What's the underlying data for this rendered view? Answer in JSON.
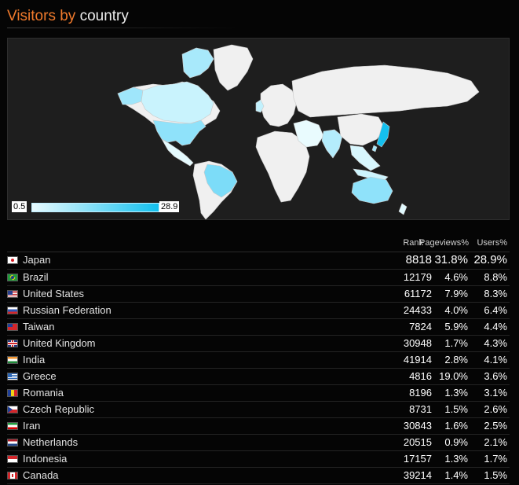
{
  "page": {
    "title_accent": "Visitors by",
    "title_rest": " country"
  },
  "map": {
    "legend_min": "0.5",
    "legend_max": "28.9",
    "color_low": "#e8fbff",
    "color_high": "#12c0ee",
    "land_color": "#f0f0f0"
  },
  "table": {
    "headers": {
      "rank": "Rank",
      "pageviews": "Pageviews%",
      "users": "Users%"
    },
    "rows": [
      {
        "country": "Japan",
        "flag": "jp-flag-icon",
        "rank": "8818",
        "pageviews": "31.8%",
        "users": "28.9%"
      },
      {
        "country": "Brazil",
        "flag": "br-flag-icon",
        "rank": "12179",
        "pageviews": "4.6%",
        "users": "8.8%"
      },
      {
        "country": "United States",
        "flag": "us-flag-icon",
        "rank": "61172",
        "pageviews": "7.9%",
        "users": "8.3%"
      },
      {
        "country": "Russian Federation",
        "flag": "ru-flag-icon",
        "rank": "24433",
        "pageviews": "4.0%",
        "users": "6.4%"
      },
      {
        "country": "Taiwan",
        "flag": "tw-flag-icon",
        "rank": "7824",
        "pageviews": "5.9%",
        "users": "4.4%"
      },
      {
        "country": "United Kingdom",
        "flag": "gb-flag-icon",
        "rank": "30948",
        "pageviews": "1.7%",
        "users": "4.3%"
      },
      {
        "country": "India",
        "flag": "in-flag-icon",
        "rank": "41914",
        "pageviews": "2.8%",
        "users": "4.1%"
      },
      {
        "country": "Greece",
        "flag": "gr-flag-icon",
        "rank": "4816",
        "pageviews": "19.0%",
        "users": "3.6%"
      },
      {
        "country": "Romania",
        "flag": "ro-flag-icon",
        "rank": "8196",
        "pageviews": "1.3%",
        "users": "3.1%"
      },
      {
        "country": "Czech Republic",
        "flag": "cz-flag-icon",
        "rank": "8731",
        "pageviews": "1.5%",
        "users": "2.6%"
      },
      {
        "country": "Iran",
        "flag": "ir-flag-icon",
        "rank": "30843",
        "pageviews": "1.6%",
        "users": "2.5%"
      },
      {
        "country": "Netherlands",
        "flag": "nl-flag-icon",
        "rank": "20515",
        "pageviews": "0.9%",
        "users": "2.1%"
      },
      {
        "country": "Indonesia",
        "flag": "id-flag-icon",
        "rank": "17157",
        "pageviews": "1.3%",
        "users": "1.7%"
      },
      {
        "country": "Canada",
        "flag": "ca-flag-icon",
        "rank": "39214",
        "pageviews": "1.4%",
        "users": "1.5%"
      }
    ]
  }
}
